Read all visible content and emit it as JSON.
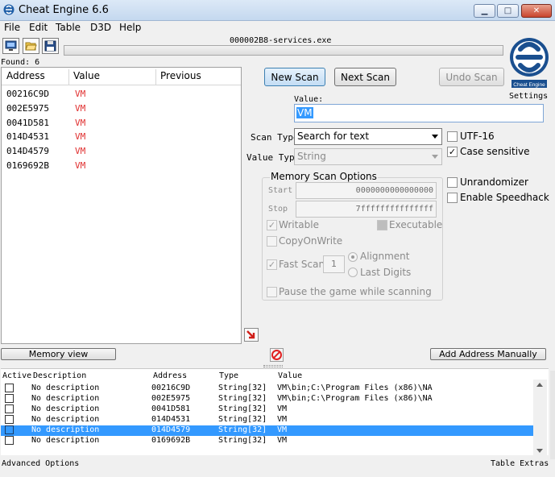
{
  "window": {
    "title": "Cheat Engine 6.6"
  },
  "menu": [
    "File",
    "Edit",
    "Table",
    "D3D",
    "Help"
  ],
  "process_title": "000002B8-services.exe",
  "found_label": "Found: 6",
  "results": {
    "headers": [
      "Address",
      "Value",
      "Previous"
    ],
    "rows": [
      {
        "address": "00216C9D",
        "value": "VM"
      },
      {
        "address": "002E5975",
        "value": "VM"
      },
      {
        "address": "0041D581",
        "value": "VM"
      },
      {
        "address": "014D4531",
        "value": "VM"
      },
      {
        "address": "014D4579",
        "value": "VM"
      },
      {
        "address": "0169692B",
        "value": "VM"
      }
    ]
  },
  "scan": {
    "new_scan": "New Scan",
    "next_scan": "Next Scan",
    "undo_scan": "Undo Scan",
    "settings": "Settings",
    "logo_text": "Cheat Engine",
    "value_label": "Value:",
    "value": "VM",
    "scan_type_label": "Scan Type",
    "scan_type": "Search for text",
    "value_type_label": "Value Type",
    "value_type": "String",
    "utf16": "UTF-16",
    "case_sensitive": "Case sensitive",
    "unrandomizer": "Unrandomizer",
    "speedhack": "Enable Speedhack"
  },
  "memory_options": {
    "title": "Memory Scan Options",
    "start_label": "Start",
    "start_value": "0000000000000000",
    "stop_label": "Stop",
    "stop_value": "7fffffffffffffff",
    "writable": "Writable",
    "executable": "Executable",
    "copy_on_write": "CopyOnWrite",
    "fast_scan": "Fast Scan",
    "fast_scan_value": "1",
    "alignment": "Alignment",
    "last_digits": "Last Digits",
    "pause": "Pause the game while scanning"
  },
  "buttons": {
    "memory_view": "Memory view",
    "add_address": "Add Address Manually"
  },
  "cheat_table": {
    "headers": [
      "Active",
      "Description",
      "Address",
      "Type",
      "Value"
    ],
    "rows": [
      {
        "description": "No description",
        "address": "00216C9D",
        "type": "String[32]",
        "value": "VM\\bin;C:\\Program Files (x86)\\NA",
        "selected": false
      },
      {
        "description": "No description",
        "address": "002E5975",
        "type": "String[32]",
        "value": "VM\\bin;C:\\Program Files (x86)\\NA",
        "selected": false
      },
      {
        "description": "No description",
        "address": "0041D581",
        "type": "String[32]",
        "value": "VM",
        "selected": false
      },
      {
        "description": "No description",
        "address": "014D4531",
        "type": "String[32]",
        "value": "VM",
        "selected": false
      },
      {
        "description": "No description",
        "address": "014D4579",
        "type": "String[32]",
        "value": "VM",
        "selected": true
      },
      {
        "description": "No description",
        "address": "0169692B",
        "type": "String[32]",
        "value": "VM",
        "selected": false
      }
    ]
  },
  "status": {
    "left": "Advanced Options",
    "right": "Table Extras"
  },
  "colors": {
    "selection": "#3399ff",
    "result_value": "#e03030",
    "accent": "#3c7fb1"
  }
}
